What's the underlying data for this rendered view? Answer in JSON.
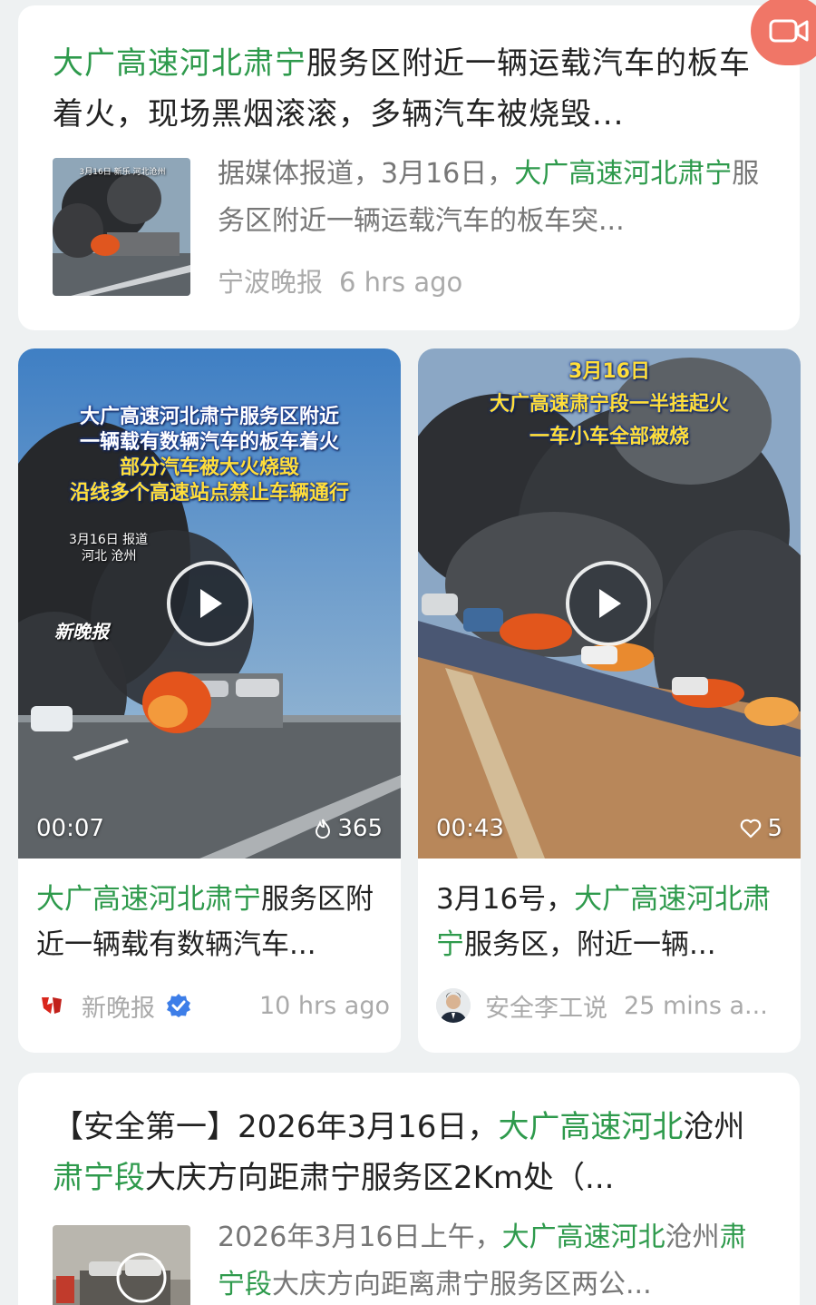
{
  "card1": {
    "title_hl": "大广高速河北肃宁",
    "title_rest": "服务区附近一辆运载汽车的板车着火，现场黑烟滚滚，多辆汽车被烧毁...",
    "summary_pre": "据媒体报道，3月16日，",
    "summary_hl": "大广高速河北肃宁",
    "summary_post": "服务区附近一辆运载汽车的板车突...",
    "source": "宁波晚报",
    "time": "6 hrs ago",
    "thumb_caption": "3月16日 新乐 河北沧州"
  },
  "video1": {
    "overlay_line1": "大广高速河北肃宁服务区附近",
    "overlay_line2": "一辆载有数辆汽车的板车着火",
    "overlay_line3": "部分汽车被大火烧毁",
    "overlay_line4": "沿线多个高速站点禁止车辆通行",
    "overlay_date": "3月16日 报道",
    "overlay_place": "河北 沧州",
    "watermark": "新晚报",
    "duration": "00:07",
    "stat": "365",
    "title_hl": "大广高速河北肃宁",
    "title_rest": "服务区附近一辆载有数辆汽车...",
    "source": "新晚报",
    "time": "10 hrs ago"
  },
  "video2": {
    "overlay_line1": "3月16日",
    "overlay_line2": "大广高速肃宁段一半挂起火",
    "overlay_line3": "一车小车全部被烧",
    "duration": "00:43",
    "stat": "5",
    "title_pre": "3月16号，",
    "title_hl1": "大广高速河北",
    "title_hl2": "肃宁",
    "title_rest": "服务区，附近一辆...",
    "source": "安全李工说",
    "time": "25 mins a..."
  },
  "card3": {
    "title_pre": "【安全第一】2026年3月16日，",
    "title_hl1": "大广高速河北",
    "title_mid": "沧州",
    "title_hl2": "肃宁段",
    "title_post": "大庆方向距肃宁服务区2Km处（...",
    "summary_pre": "2026年3月16日上午，",
    "summary_hl1": "大广高速河北",
    "summary_mid": "沧州",
    "summary_hl2": "肃宁段",
    "summary_post": "大庆方向距离肃宁服务区两公..."
  },
  "colors": {
    "highlight": "#2e9a4c",
    "fab": "#f07667",
    "verified": "#3d7ee8"
  },
  "icons": [
    "video-camera-icon",
    "play-icon",
    "flame-icon",
    "heart-icon",
    "verified-badge-icon"
  ]
}
